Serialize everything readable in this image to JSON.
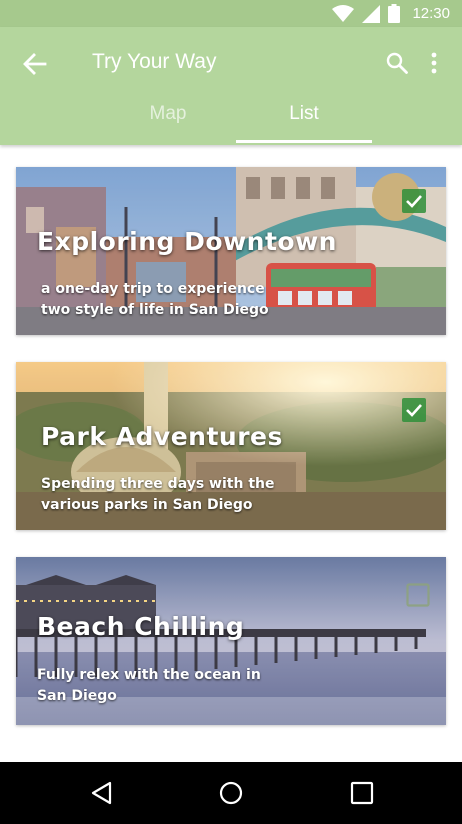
{
  "status_bar": {
    "time": "12:30",
    "icons": [
      "wifi-icon",
      "cellular-signal-icon",
      "battery-icon"
    ]
  },
  "app_bar": {
    "title": "Try Your Way",
    "tabs": [
      {
        "label": "Map",
        "selected": false
      },
      {
        "label": "List",
        "selected": true
      }
    ],
    "icons": [
      "arrow-back-icon",
      "search-icon",
      "more-vert-icon"
    ],
    "color": "#b4d69d"
  },
  "cards": [
    {
      "title": "Exploring Downtown",
      "subtitle": "a one-day trip to experience two style of life in San Diego",
      "checked": true
    },
    {
      "title": "Park Adventures",
      "subtitle": "Spending three days with the various parks in San Diego",
      "checked": true
    },
    {
      "title": "Beach Chilling",
      "subtitle": "Fully relex with the ocean in San Diego",
      "checked": false
    }
  ],
  "nav_bar": {
    "icons": [
      "back-triangle-icon",
      "home-circle-icon",
      "recents-square-icon"
    ]
  },
  "colors": {
    "check_green": "#2f8f3a",
    "status_bar": "#a6c98d"
  }
}
